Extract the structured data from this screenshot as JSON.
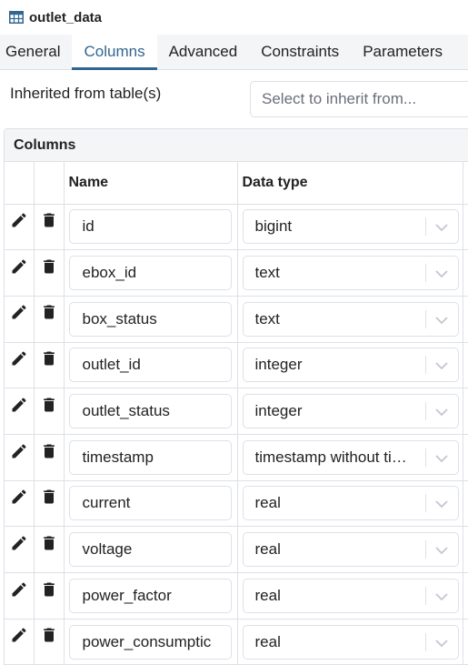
{
  "window": {
    "title": "outlet_data",
    "icon": "table-icon"
  },
  "tabs": [
    {
      "label": "General",
      "active": false
    },
    {
      "label": "Columns",
      "active": true
    },
    {
      "label": "Advanced",
      "active": false
    },
    {
      "label": "Constraints",
      "active": false
    },
    {
      "label": "Parameters",
      "active": false
    }
  ],
  "inherit": {
    "label": "Inherited from table(s)",
    "placeholder": "Select to inherit from..."
  },
  "columns_section": {
    "title": "Columns",
    "headers": {
      "name": "Name",
      "data_type": "Data type"
    },
    "row_icons": {
      "edit": "pencil-icon",
      "delete": "trash-icon",
      "dropdown": "chevron-down-icon"
    },
    "rows": [
      {
        "name": "id",
        "data_type": "bigint"
      },
      {
        "name": "ebox_id",
        "data_type": "text"
      },
      {
        "name": "box_status",
        "data_type": "text"
      },
      {
        "name": "outlet_id",
        "data_type": "integer"
      },
      {
        "name": "outlet_status",
        "data_type": "integer"
      },
      {
        "name": "timestamp",
        "data_type": "timestamp without time zone"
      },
      {
        "name": "current",
        "data_type": "real"
      },
      {
        "name": "voltage",
        "data_type": "real"
      },
      {
        "name": "power_factor",
        "data_type": "real"
      },
      {
        "name": "power_consumptic",
        "data_type": "real"
      }
    ]
  },
  "colors": {
    "accent": "#326690",
    "border": "#dde0e6",
    "tab_bg": "#f4f5f7"
  }
}
